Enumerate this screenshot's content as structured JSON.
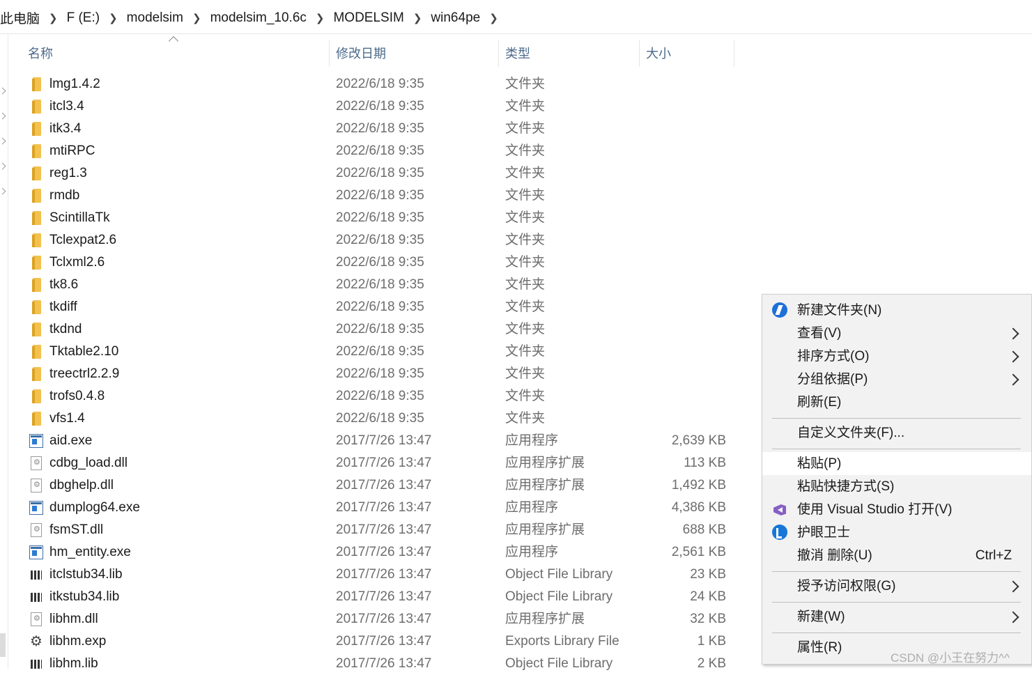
{
  "breadcrumb": [
    "此电脑",
    "F (E:)",
    "modelsim",
    "modelsim_10.6c",
    "MODELSIM",
    "win64pe"
  ],
  "breadcrumb_display_first": "此电脑",
  "columns": {
    "name": "名称",
    "date": "修改日期",
    "type": "类型",
    "size": "大小"
  },
  "files": [
    {
      "name": "lmg1.4.2",
      "date": "2022/6/18 9:35",
      "type": "文件夹",
      "size": "",
      "icon": "folder-icon"
    },
    {
      "name": "itcl3.4",
      "date": "2022/6/18 9:35",
      "type": "文件夹",
      "size": "",
      "icon": "folder-icon"
    },
    {
      "name": "itk3.4",
      "date": "2022/6/18 9:35",
      "type": "文件夹",
      "size": "",
      "icon": "folder-icon"
    },
    {
      "name": "mtiRPC",
      "date": "2022/6/18 9:35",
      "type": "文件夹",
      "size": "",
      "icon": "folder-icon"
    },
    {
      "name": "reg1.3",
      "date": "2022/6/18 9:35",
      "type": "文件夹",
      "size": "",
      "icon": "folder-icon"
    },
    {
      "name": "rmdb",
      "date": "2022/6/18 9:35",
      "type": "文件夹",
      "size": "",
      "icon": "folder-icon"
    },
    {
      "name": "ScintillaTk",
      "date": "2022/6/18 9:35",
      "type": "文件夹",
      "size": "",
      "icon": "folder-icon"
    },
    {
      "name": "Tclexpat2.6",
      "date": "2022/6/18 9:35",
      "type": "文件夹",
      "size": "",
      "icon": "folder-icon"
    },
    {
      "name": "Tclxml2.6",
      "date": "2022/6/18 9:35",
      "type": "文件夹",
      "size": "",
      "icon": "folder-icon"
    },
    {
      "name": "tk8.6",
      "date": "2022/6/18 9:35",
      "type": "文件夹",
      "size": "",
      "icon": "folder-icon"
    },
    {
      "name": "tkdiff",
      "date": "2022/6/18 9:35",
      "type": "文件夹",
      "size": "",
      "icon": "folder-icon"
    },
    {
      "name": "tkdnd",
      "date": "2022/6/18 9:35",
      "type": "文件夹",
      "size": "",
      "icon": "folder-icon"
    },
    {
      "name": "Tktable2.10",
      "date": "2022/6/18 9:35",
      "type": "文件夹",
      "size": "",
      "icon": "folder-icon"
    },
    {
      "name": "treectrl2.2.9",
      "date": "2022/6/18 9:35",
      "type": "文件夹",
      "size": "",
      "icon": "folder-icon"
    },
    {
      "name": "trofs0.4.8",
      "date": "2022/6/18 9:35",
      "type": "文件夹",
      "size": "",
      "icon": "folder-icon"
    },
    {
      "name": "vfs1.4",
      "date": "2022/6/18 9:35",
      "type": "文件夹",
      "size": "",
      "icon": "folder-icon"
    },
    {
      "name": "aid.exe",
      "date": "2017/7/26 13:47",
      "type": "应用程序",
      "size": "2,639 KB",
      "icon": "exe-icon"
    },
    {
      "name": "cdbg_load.dll",
      "date": "2017/7/26 13:47",
      "type": "应用程序扩展",
      "size": "113 KB",
      "icon": "dll-icon"
    },
    {
      "name": "dbghelp.dll",
      "date": "2017/7/26 13:47",
      "type": "应用程序扩展",
      "size": "1,492 KB",
      "icon": "dll-icon"
    },
    {
      "name": "dumplog64.exe",
      "date": "2017/7/26 13:47",
      "type": "应用程序",
      "size": "4,386 KB",
      "icon": "exe-icon"
    },
    {
      "name": "fsmST.dll",
      "date": "2017/7/26 13:47",
      "type": "应用程序扩展",
      "size": "688 KB",
      "icon": "dll-icon"
    },
    {
      "name": "hm_entity.exe",
      "date": "2017/7/26 13:47",
      "type": "应用程序",
      "size": "2,561 KB",
      "icon": "exe-icon"
    },
    {
      "name": "itclstub34.lib",
      "date": "2017/7/26 13:47",
      "type": "Object File Library",
      "size": "23 KB",
      "icon": "lib-icon"
    },
    {
      "name": "itkstub34.lib",
      "date": "2017/7/26 13:47",
      "type": "Object File Library",
      "size": "24 KB",
      "icon": "lib-icon"
    },
    {
      "name": "libhm.dll",
      "date": "2017/7/26 13:47",
      "type": "应用程序扩展",
      "size": "32 KB",
      "icon": "dll-icon"
    },
    {
      "name": "libhm.exp",
      "date": "2017/7/26 13:47",
      "type": "Exports Library File",
      "size": "1 KB",
      "icon": "gear-icon"
    },
    {
      "name": "libhm.lib",
      "date": "2017/7/26 13:47",
      "type": "Object File Library",
      "size": "2 KB",
      "icon": "lib-icon"
    }
  ],
  "context_menu": {
    "items": [
      {
        "label": "新建文件夹(N)",
        "icon": "new-folder-icon",
        "submenu": false
      },
      {
        "label": "查看(V)",
        "submenu": true
      },
      {
        "label": "排序方式(O)",
        "submenu": true
      },
      {
        "label": "分组依据(P)",
        "submenu": true
      },
      {
        "label": "刷新(E)",
        "submenu": false
      },
      {
        "label": "自定义文件夹(F)...",
        "submenu": false
      },
      {
        "label": "粘贴(P)",
        "submenu": false,
        "highlighted": true
      },
      {
        "label": "粘贴快捷方式(S)",
        "submenu": false
      },
      {
        "label": "使用 Visual Studio 打开(V)",
        "icon": "visual-studio-icon",
        "submenu": false
      },
      {
        "label": "护眼卫士",
        "icon": "eye-guard-icon",
        "submenu": false
      },
      {
        "label": "撤消 删除(U)",
        "accelerator": "Ctrl+Z",
        "submenu": false
      },
      {
        "label": "授予访问权限(G)",
        "submenu": true
      },
      {
        "label": "新建(W)",
        "submenu": true
      },
      {
        "label": "属性(R)",
        "submenu": false
      }
    ]
  },
  "watermark": "CSDN @小王在努力^^",
  "colors": {
    "header_text": "#4d6b8c",
    "folder": "#f2c14e",
    "menu_bg": "#f2f2f2",
    "menu_highlight": "#ffffff"
  }
}
